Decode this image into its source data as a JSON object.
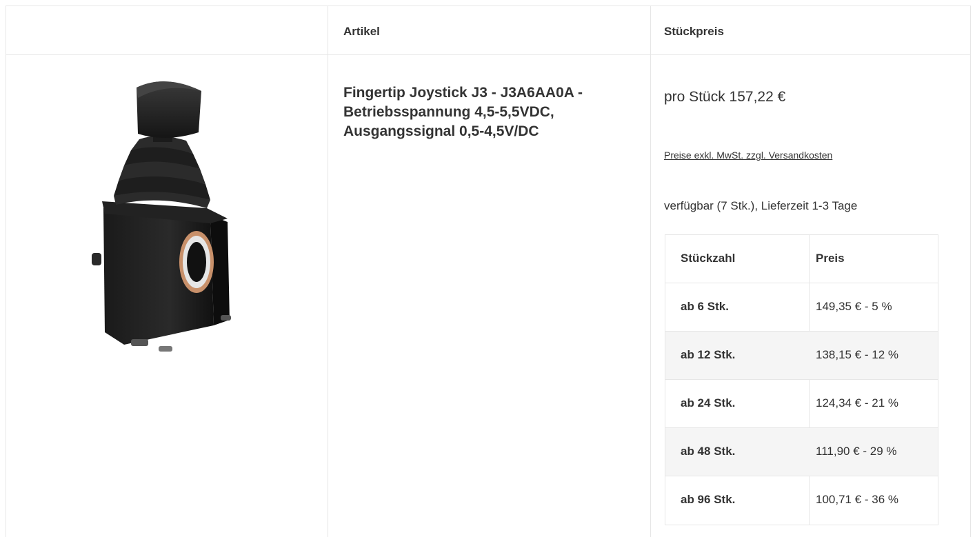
{
  "table": {
    "headers": {
      "image": "",
      "article": "Artikel",
      "unit_price": "Stückpreis"
    }
  },
  "product": {
    "title": "Fingertip Joystick J3 - J3A6AA0A - Betriebsspannung 4,5-5,5VDC, Ausgangssignal 0,5-4,5V/DC",
    "image_icon": "joystick-product-image",
    "unit_price": "pro Stück 157,22 €",
    "vat_note": "Preise exkl. MwSt. zzgl. Versandkosten",
    "availability": "verfügbar (7 Stk.), Lieferzeit 1-3 Tage"
  },
  "tiers": {
    "header": {
      "qty": "Stückzahl",
      "price": "Preis"
    },
    "rows": [
      {
        "qty": "ab 6 Stk.",
        "price": "149,35 € - 5 %"
      },
      {
        "qty": "ab 12 Stk.",
        "price": "138,15 € - 12 %"
      },
      {
        "qty": "ab 24 Stk.",
        "price": "124,34 € - 21 %"
      },
      {
        "qty": "ab 48 Stk.",
        "price": "111,90 € - 29 %"
      },
      {
        "qty": "ab 96 Stk.",
        "price": "100,71 € - 36 %"
      }
    ]
  },
  "colors": {
    "border": "#e6e6e6",
    "text": "#333333",
    "row_alt": "#f5f5f5",
    "copper": "#c8906a"
  }
}
